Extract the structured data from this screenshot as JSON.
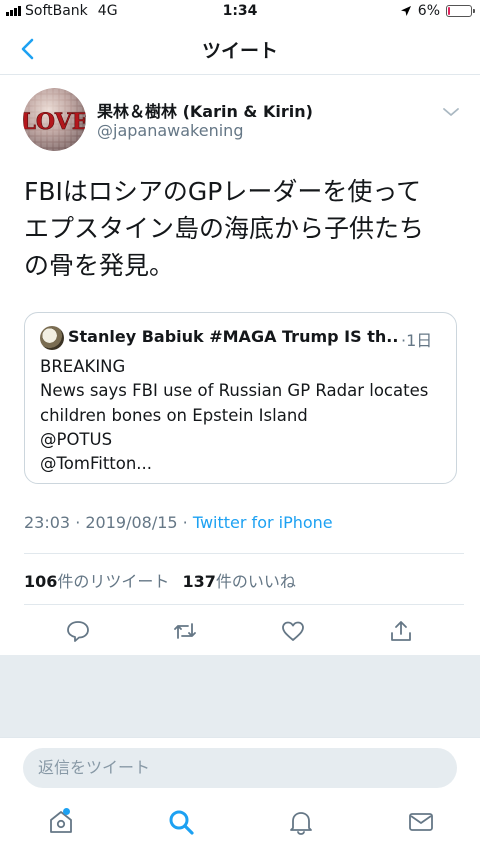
{
  "status_bar": {
    "carrier": "SoftBank",
    "network": "4G",
    "time": "1:34",
    "battery_percent": "6%",
    "battery_level": 0.06,
    "battery_color": "#e0245e"
  },
  "nav": {
    "title": "ツイート",
    "back_icon": "chevron-left-icon"
  },
  "tweet": {
    "display_name": "果林＆樹林 (Karin & Kirin)",
    "handle": "@japanawakening",
    "avatar_text": "LOVE",
    "text_lines": [
      "FBIはロシアのGPレーダーを使って",
      "エプスタイン島の海底から子供たち",
      "の骨を発見。"
    ],
    "quote": {
      "name": "Stanley Babiuk #MAGA Trump IS th...",
      "time": "·1日",
      "lines": [
        "BREAKING",
        "News says FBI use of Russian GP Radar locates",
        "children bones on Epstein Island",
        "@POTUS",
        "@TomFitton..."
      ]
    },
    "timestamp": "23:03 · 2019/08/15 · ",
    "source": "Twitter for iPhone",
    "retweets_count": "106",
    "retweets_label": "件のリツイート",
    "likes_count": "137",
    "likes_label": "件のいいね"
  },
  "actions": [
    "reply-icon",
    "retweet-icon",
    "like-icon",
    "share-icon"
  ],
  "reply": {
    "placeholder": "返信をツイート"
  },
  "tabbar": [
    "home-icon",
    "search-icon",
    "notifications-icon",
    "messages-icon"
  ],
  "colors": {
    "accent": "#1da1f2",
    "muted": "#657786",
    "border": "#e1e8ed",
    "background_gray": "#e6ecf0"
  }
}
